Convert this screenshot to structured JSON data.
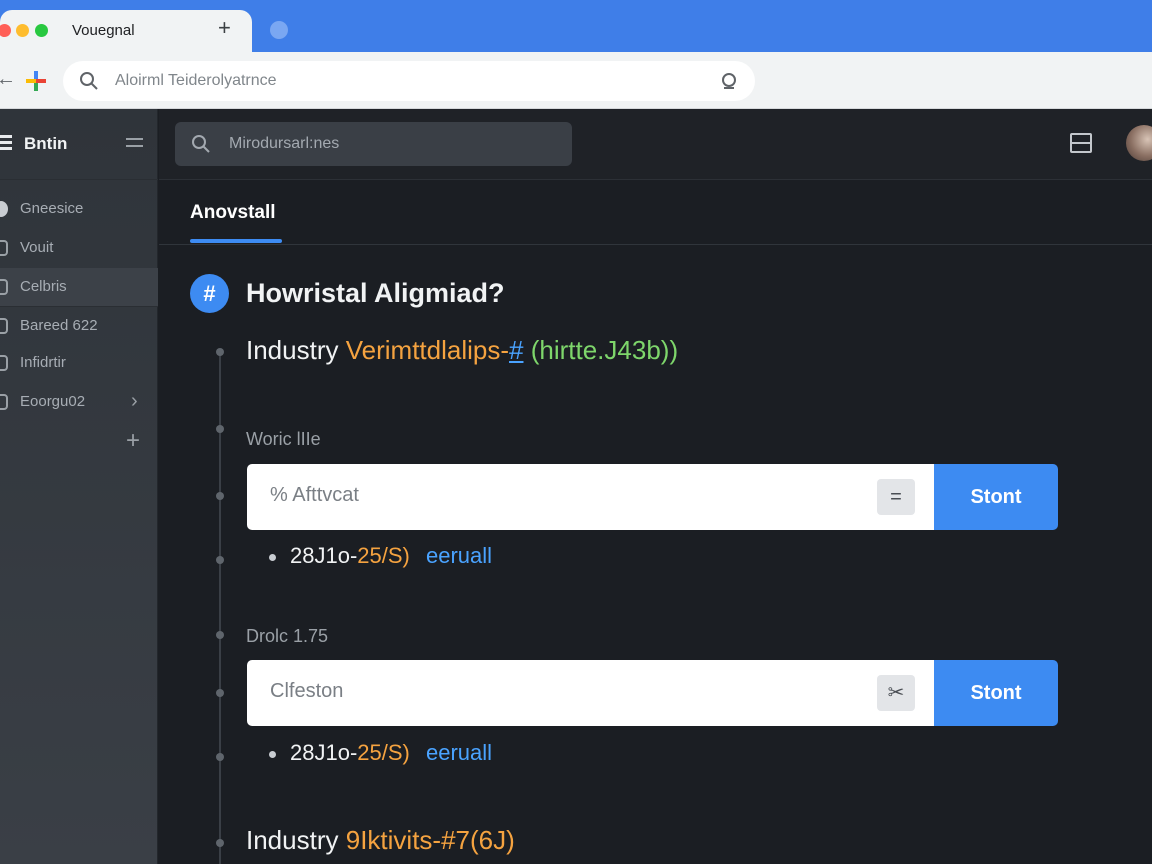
{
  "browser": {
    "tab_title": "Vouegnal",
    "tab_plus": "+",
    "address_text": "Aloirml Teiderolyatrnce",
    "traffic_light_colors": [
      "#ff5f57",
      "#febc2e",
      "#28c840"
    ]
  },
  "sidebar": {
    "title": "Bntin",
    "items": [
      {
        "label": "Gneesice",
        "icon": "circle-icon"
      },
      {
        "label": "Vouit",
        "icon": "square-icon"
      },
      {
        "label": "Celbris",
        "icon": "square-icon"
      },
      {
        "label": "Bareed 622",
        "icon": "square-icon"
      },
      {
        "label": "Infidrtir",
        "icon": "square-icon"
      },
      {
        "label": "Eoorgu02",
        "icon": "square-icon"
      }
    ],
    "add_label": "+"
  },
  "header": {
    "search_placeholder": "Mirodursarl:nes"
  },
  "tabs": [
    {
      "label": "Anovstall",
      "active": true
    }
  ],
  "main": {
    "badge_symbol": "#",
    "section_title": "Howristal Aligmiad?",
    "industry_1": {
      "prefix": "Industry",
      "orange": "Verimttdlalips-",
      "blue": "#",
      "green": "(hirtte.J43b))"
    },
    "field_1": {
      "label": "Woric lIIe",
      "input_value": "% Afttvcat",
      "icon_glyph": "=",
      "button_label": "Stont",
      "meta_date_white": "28J1o-",
      "meta_date_orange": "25/S)",
      "meta_link": "eeruall"
    },
    "field_2": {
      "label": "Drolc 1.75",
      "input_value": "Clfeston",
      "icon_glyph": "✂",
      "button_label": "Stont",
      "meta_date_white": "28J1o-",
      "meta_date_orange": "25/S)",
      "meta_link": "eeruall"
    },
    "industry_2": {
      "prefix": "Industry",
      "orange": "9Iktivits-#7(6J)"
    }
  },
  "colors": {
    "accent": "#3d8bf2",
    "orange": "#f5a340",
    "green": "#7ed66b",
    "link": "#4aa3ff"
  }
}
